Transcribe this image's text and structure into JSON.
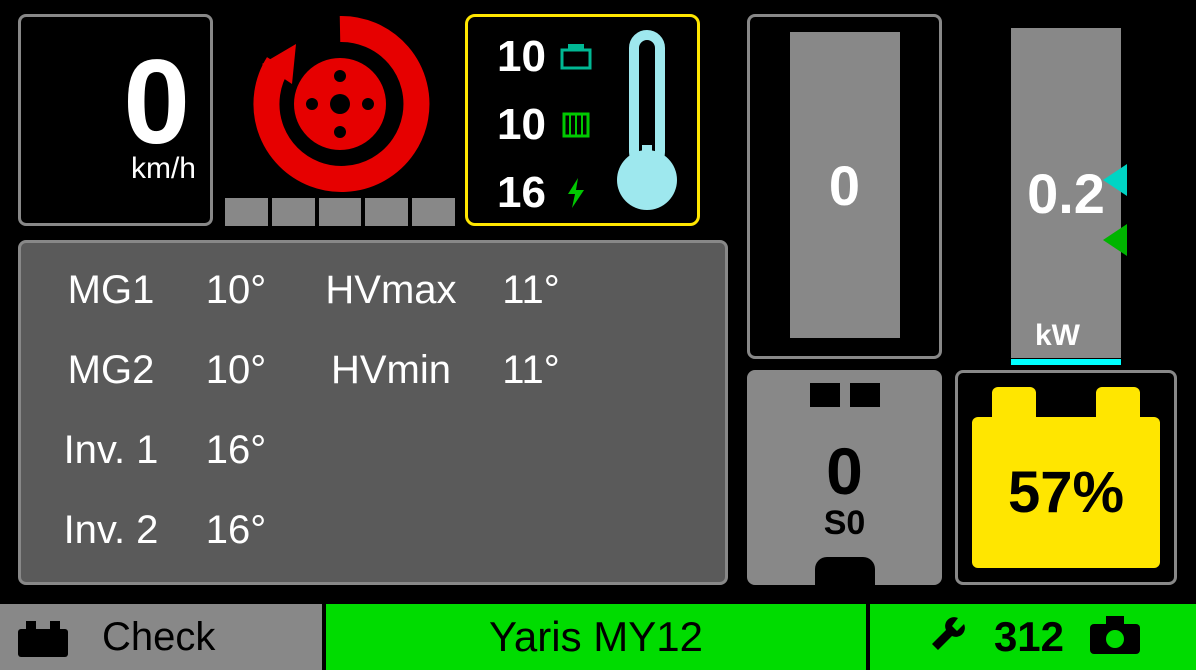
{
  "speed": {
    "value": "0",
    "unit": "km/h"
  },
  "temps_small": {
    "t1": "10",
    "t2": "10",
    "t3": "16"
  },
  "gauges": {
    "left": "0",
    "right": "0.2",
    "unit": "kW"
  },
  "temps_table": {
    "mg1_label": "MG1",
    "mg1_val": "10°",
    "mg2_label": "MG2",
    "mg2_val": "10°",
    "inv1_label": "Inv. 1",
    "inv1_val": "16°",
    "inv2_label": "Inv. 2",
    "inv2_val": "16°",
    "hvmax_label": "HVmax",
    "hvmax_val": "11°",
    "hvmin_label": "HVmin",
    "hvmin_val": "11°"
  },
  "engine": {
    "value": "0",
    "sub": "S0"
  },
  "battery": {
    "pct": "57%"
  },
  "bottom": {
    "check": "Check",
    "model": "Yaris MY12",
    "stat": "312"
  }
}
